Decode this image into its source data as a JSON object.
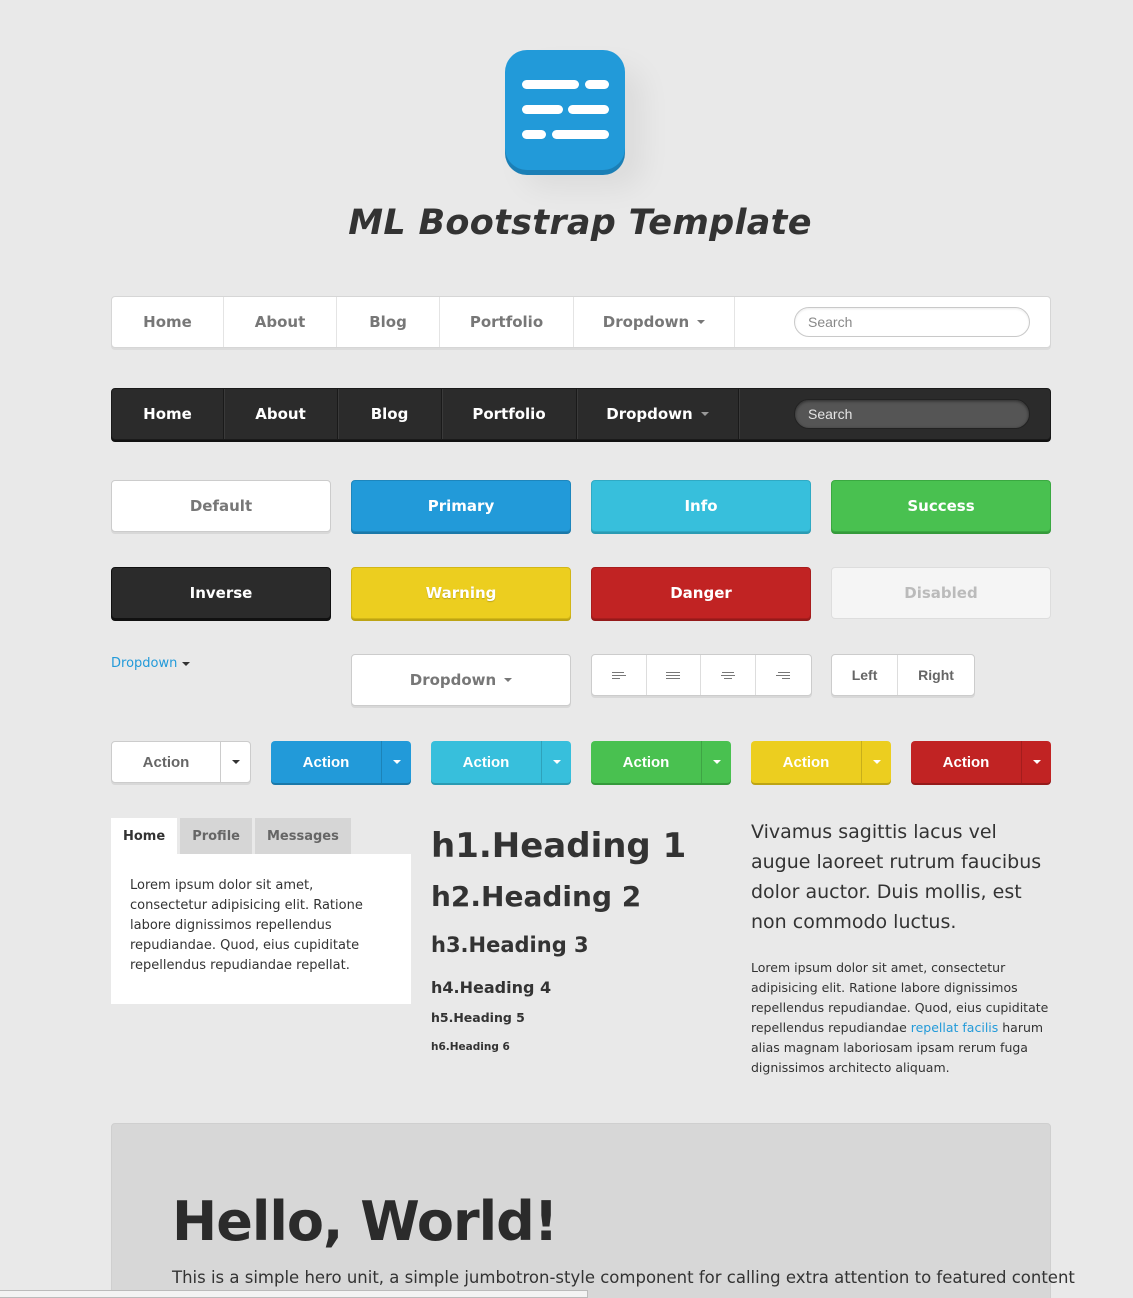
{
  "app": {
    "title": "ML Bootstrap Template",
    "logo_icon": "list-lines-icon",
    "accent": "#229ad9"
  },
  "navbar_light": {
    "items": [
      "Home",
      "About",
      "Blog",
      "Portfolio",
      "Dropdown"
    ],
    "search_placeholder": "Search"
  },
  "navbar_dark": {
    "items": [
      "Home",
      "About",
      "Blog",
      "Portfolio",
      "Dropdown"
    ],
    "search_placeholder": "Search"
  },
  "buttons": {
    "default": "Default",
    "primary": "Primary",
    "info": "Info",
    "success": "Success",
    "inverse": "Inverse",
    "warning": "Warning",
    "danger": "Danger",
    "disabled": "Disabled"
  },
  "colors": {
    "primary": "#229ad9",
    "info": "#37bfdc",
    "success": "#49c150",
    "inverse": "#2b2b2b",
    "warning": "#ecce1f",
    "danger": "#c12323"
  },
  "dropdown_link": "Dropdown",
  "dropdown_button": "Dropdown",
  "align_group": {
    "icons": [
      "align-left-icon",
      "align-justify-icon",
      "align-center-icon",
      "align-right-icon"
    ]
  },
  "left_right_group": {
    "left": "Left",
    "right": "Right"
  },
  "split_buttons": [
    "Action",
    "Action",
    "Action",
    "Action",
    "Action",
    "Action"
  ],
  "tabs": {
    "items": [
      "Home",
      "Profile",
      "Messages"
    ],
    "active": "Home",
    "content": "Lorem ipsum dolor sit amet, consectetur adipisicing elit. Ratione labore dignissimos repellendus repudiandae. Quod, eius cupiditate repellendus repudiandae repellat."
  },
  "headings": {
    "h1": "h1.Heading 1",
    "h2": "h2.Heading 2",
    "h3": "h3.Heading 3",
    "h4": "h4.Heading 4",
    "h5": "h5.Heading 5",
    "h6": "h6.Heading 6"
  },
  "lead_text": "Vivamus sagittis lacus vel augue laoreet rutrum faucibus dolor auctor. Duis mollis, est non commodo luctus.",
  "paragraph": {
    "before": "Lorem ipsum dolor sit amet, consectetur adipisicing elit. Ratione labore dignissimos repellendus repudiandae. Quod, eius cupiditate repellendus repudiandae ",
    "link": "repellat facilis",
    "after": " harum alias magnam laboriosam ipsam rerum fuga dignissimos architecto aliquam."
  },
  "hero": {
    "title": "Hello, World!",
    "text": "This is a simple hero unit, a simple jumbotron-style component for calling extra attention to featured content"
  }
}
